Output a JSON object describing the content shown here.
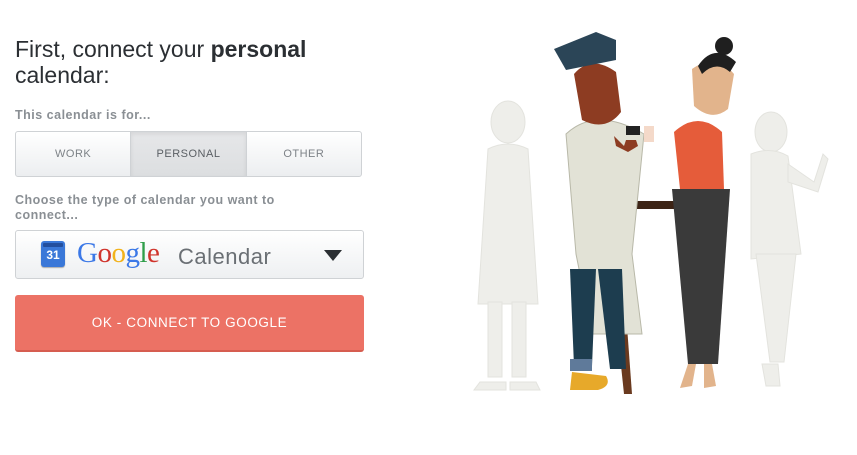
{
  "heading": {
    "prefix": "First, connect your ",
    "emphasis": "personal",
    "suffix": "calendar:"
  },
  "calendar_for": {
    "label": "This calendar is for...",
    "options": [
      "WORK",
      "PERSONAL",
      "OTHER"
    ],
    "selected": "PERSONAL"
  },
  "calendar_type": {
    "label": "Choose the type of calendar you want to connect...",
    "icon_day": "31",
    "brand_letters": [
      "G",
      "o",
      "o",
      "g",
      "l",
      "e"
    ],
    "product": "Calendar",
    "icon": "chevron-down-icon"
  },
  "connect_button": {
    "label": "OK - CONNECT TO GOOGLE"
  },
  "colors": {
    "accent": "#ec7265",
    "heading": "#2b2f33",
    "label": "#8a8f94",
    "google_blue": "#3b78e7",
    "google_red": "#d0342c",
    "google_yellow": "#f2b21a",
    "google_green": "#2f9e4a"
  }
}
